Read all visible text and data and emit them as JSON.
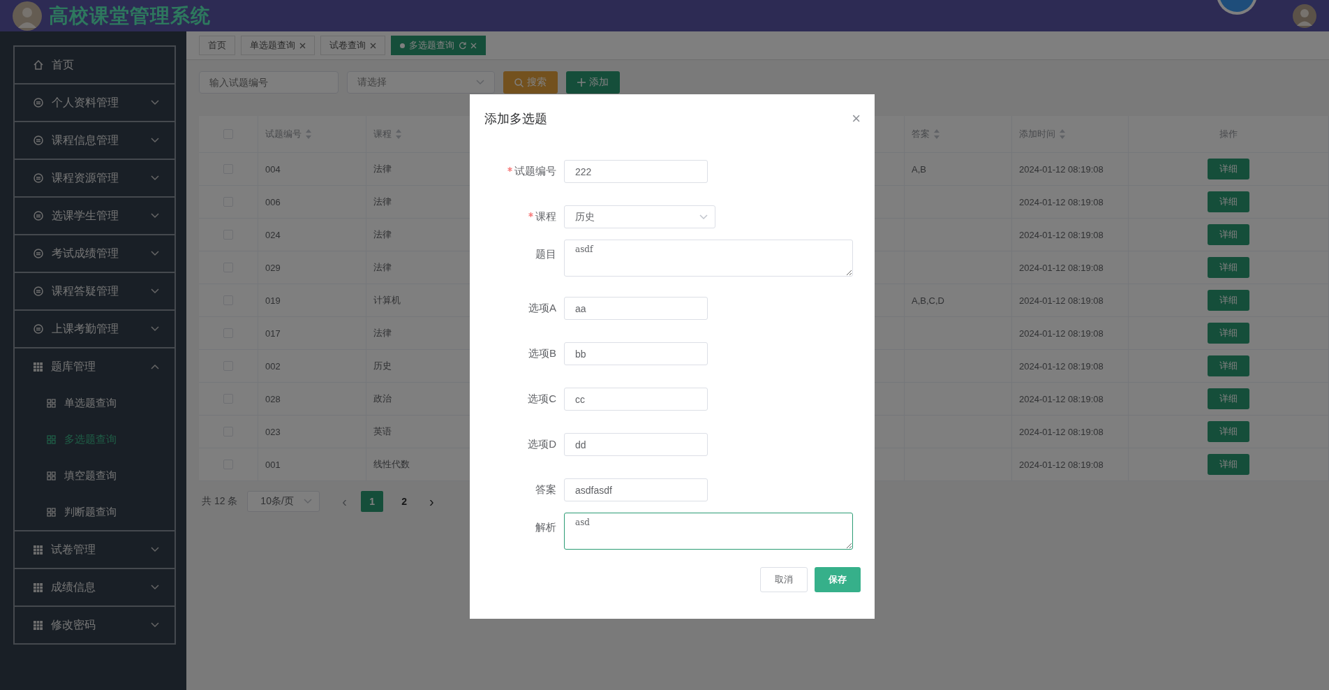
{
  "header": {
    "title": "高校课堂管理系统"
  },
  "sidebar": {
    "items": [
      {
        "label": "首页",
        "kind": "home"
      },
      {
        "label": "个人资料管理",
        "kind": "module",
        "expanded": false
      },
      {
        "label": "课程信息管理",
        "kind": "module",
        "expanded": false
      },
      {
        "label": "课程资源管理",
        "kind": "module",
        "expanded": false
      },
      {
        "label": "选课学生管理",
        "kind": "module",
        "expanded": false
      },
      {
        "label": "考试成绩管理",
        "kind": "module",
        "expanded": false
      },
      {
        "label": "课程答疑管理",
        "kind": "module",
        "expanded": false
      },
      {
        "label": "上课考勤管理",
        "kind": "module",
        "expanded": false
      },
      {
        "label": "题库管理",
        "kind": "grid",
        "expanded": true,
        "children": [
          {
            "label": "单选题查询",
            "selected": false
          },
          {
            "label": "多选题查询",
            "selected": true
          },
          {
            "label": "填空题查询",
            "selected": false
          },
          {
            "label": "判断题查询",
            "selected": false
          }
        ]
      },
      {
        "label": "试卷管理",
        "kind": "grid",
        "expanded": false
      },
      {
        "label": "成绩信息",
        "kind": "grid",
        "expanded": false
      },
      {
        "label": "修改密码",
        "kind": "grid",
        "expanded": false
      }
    ]
  },
  "tabs": [
    {
      "label": "首页",
      "selected": false,
      "closable": false
    },
    {
      "label": "单选题查询",
      "selected": false,
      "closable": true
    },
    {
      "label": "试卷查询",
      "selected": false,
      "closable": true
    },
    {
      "label": "多选题查询",
      "selected": true,
      "closable": true
    }
  ],
  "search": {
    "id_placeholder": "输入试题编号",
    "select_placeholder": "请选择",
    "search_button": "搜索",
    "add_button": "添加"
  },
  "table": {
    "all_checked": false,
    "columns": [
      {
        "label": "试题编号",
        "sortable": true
      },
      {
        "label": "课程",
        "sortable": true
      },
      {
        "label": "答案",
        "sortable": true
      },
      {
        "label": "添加时间",
        "sortable": true
      },
      {
        "label": "操作",
        "sortable": false
      }
    ],
    "rows": [
      {
        "checked": false,
        "id": "004",
        "course": "法律",
        "answer": "A,B",
        "time": "2024-01-12 08:19:08",
        "action": "详细"
      },
      {
        "checked": false,
        "id": "006",
        "course": "法律",
        "time": "2024-01-12 08:19:08",
        "action": "详细"
      },
      {
        "checked": false,
        "id": "024",
        "course": "法律",
        "time": "2024-01-12 08:19:08",
        "action": "详细"
      },
      {
        "checked": false,
        "id": "029",
        "course": "法律",
        "time": "2024-01-12 08:19:08",
        "action": "详细"
      },
      {
        "checked": false,
        "id": "019",
        "course": "计算机",
        "answer": "A,B,C,D",
        "time": "2024-01-12 08:19:08",
        "action": "详细"
      },
      {
        "checked": false,
        "id": "017",
        "course": "法律",
        "time": "2024-01-12 08:19:08",
        "action": "详细"
      },
      {
        "checked": false,
        "id": "002",
        "course": "历史",
        "time": "2024-01-12 08:19:08",
        "action": "详细"
      },
      {
        "checked": false,
        "id": "028",
        "course": "政治",
        "time": "2024-01-12 08:19:08",
        "action": "详细"
      },
      {
        "checked": false,
        "id": "023",
        "course": "英语",
        "time": "2024-01-12 08:19:08",
        "action": "详细"
      },
      {
        "checked": false,
        "id": "001",
        "course": "线性代数",
        "time": "2024-01-12 08:19:08",
        "action": "详细"
      }
    ]
  },
  "pagination": {
    "total": "共 12 条",
    "page_size": "10条/页",
    "prev": "‹",
    "next": "›",
    "pages": [
      {
        "label": "1",
        "selected": true
      },
      {
        "label": "2",
        "selected": false
      }
    ]
  },
  "dialog": {
    "title": "添加多选题",
    "close": "×",
    "fields": [
      {
        "label": "试题编号",
        "required": true,
        "kind": "input",
        "value": "222"
      },
      {
        "label": "课程",
        "required": true,
        "kind": "select",
        "value": "历史"
      },
      {
        "label": "题目",
        "required": false,
        "kind": "textarea",
        "value": "asdf",
        "focused": false
      },
      {
        "label": "选项A",
        "required": false,
        "kind": "input",
        "value": "aa"
      },
      {
        "label": "选项B",
        "required": false,
        "kind": "input",
        "value": "bb"
      },
      {
        "label": "选项C",
        "required": false,
        "kind": "input",
        "value": "cc"
      },
      {
        "label": "选项D",
        "required": false,
        "kind": "input",
        "value": "dd"
      },
      {
        "label": "答案",
        "required": false,
        "kind": "input",
        "value": "asdfasdf"
      },
      {
        "label": "解析",
        "required": false,
        "kind": "textarea",
        "value": "asd",
        "focused": true
      }
    ],
    "cancel_button": "取消",
    "save_button": "保存"
  }
}
